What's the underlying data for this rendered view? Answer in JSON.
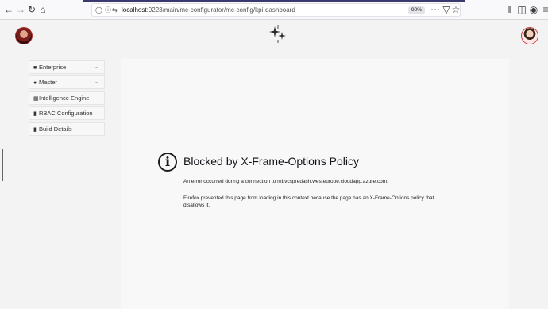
{
  "browser": {
    "url_host": "localhost",
    "url_path": ":9223/main/mc-configurator/mc-config/kpi-dashboard",
    "zoom": "90%",
    "icons": [
      "back-arrow-icon",
      "forward-arrow-icon",
      "reload-icon",
      "home-icon",
      "shield-icon",
      "info-icon",
      "permissions-icon",
      "more-icon",
      "pocket-icon",
      "bookmark-star-icon",
      "library-icon",
      "sidebar-icon",
      "account-icon",
      "menu-icon"
    ]
  },
  "sidebar": {
    "items": [
      {
        "label": "Enterprise",
        "icon": "folder-icon",
        "expandable": true
      },
      {
        "label": "Master",
        "icon": "user-icon",
        "expandable": true
      },
      {
        "label": "Intelligence Engine",
        "icon": "grid-icon",
        "expandable": false
      },
      {
        "label": "RBAC Configuration",
        "icon": "file-icon",
        "expandable": false
      },
      {
        "label": "Build Details",
        "icon": "file-icon",
        "expandable": false
      }
    ]
  },
  "error": {
    "title": "Blocked by X-Frame-Options Policy",
    "message": "An error occurred during a connection to mbvcspredash.westeurope.cloudapp.azure.com.",
    "details": "Firefox prevented this page from loading in this context because the page has an X-Frame-Options policy that disallows it."
  },
  "colors": {
    "page_bg": "#f3f3f3",
    "frame_bg": "#f8f8f9",
    "progress": "#3a3a6e"
  }
}
